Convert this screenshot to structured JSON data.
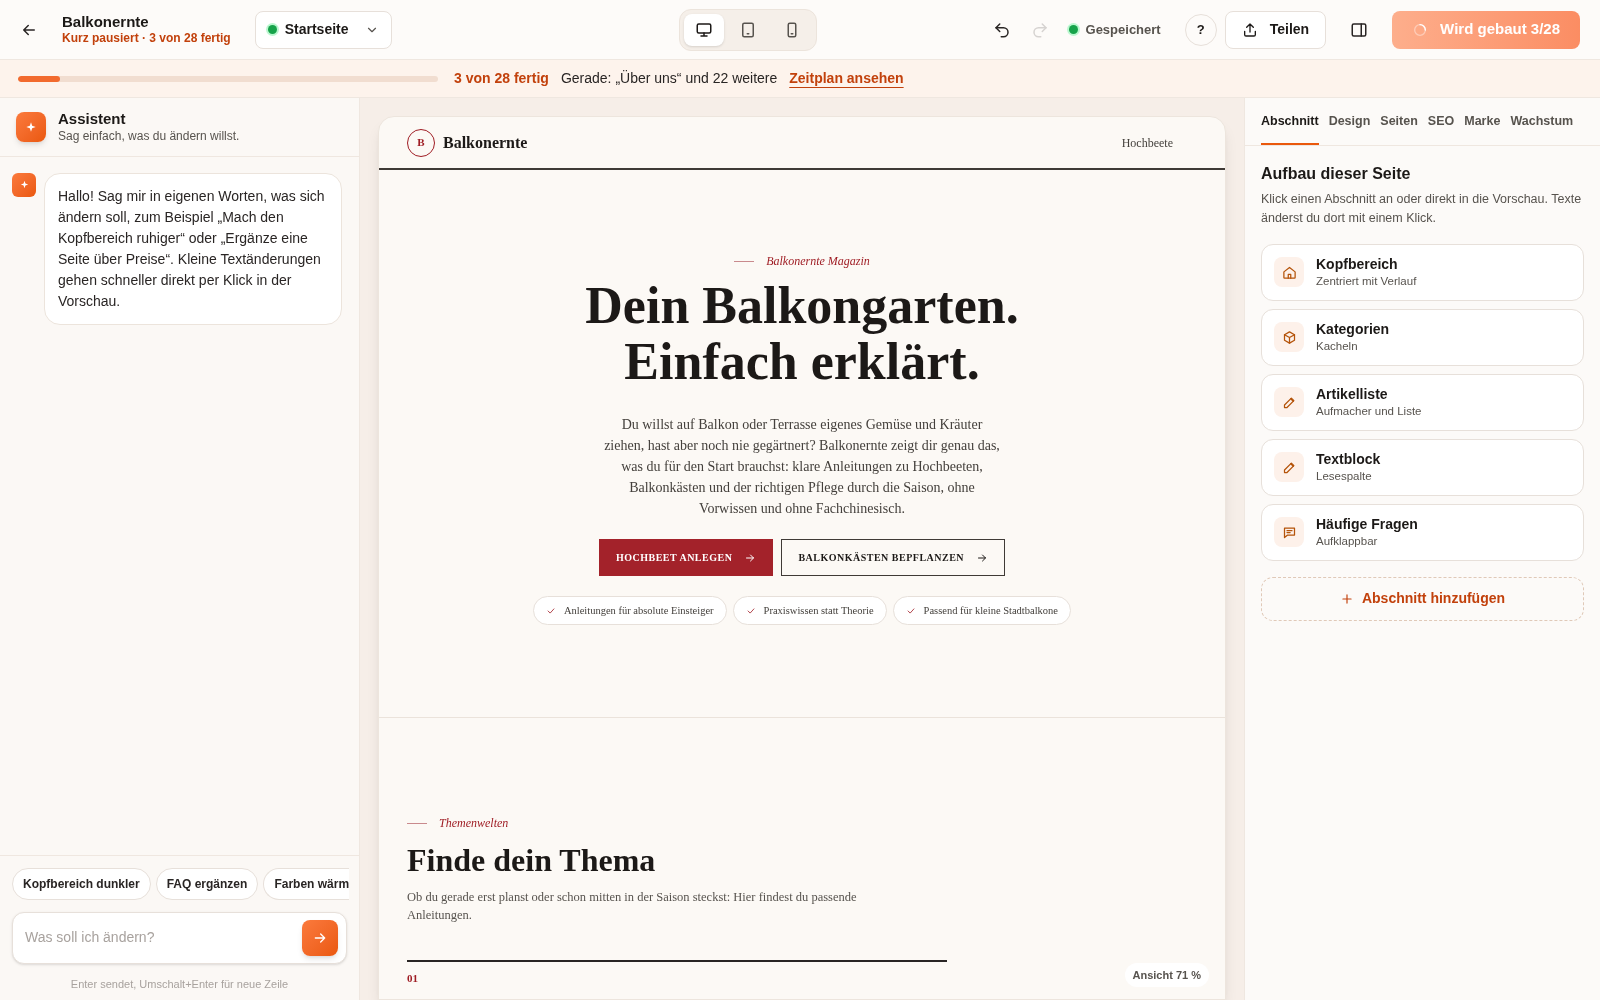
{
  "topbar": {
    "project": "Balkonernte",
    "status": "Kurz pausiert · 3 von 28 fertig",
    "page_select": "Startseite",
    "devices": [
      {
        "kind": "desktop",
        "selected": true
      },
      {
        "kind": "tablet",
        "selected": false
      },
      {
        "kind": "phone",
        "selected": false
      }
    ],
    "redo_disabled": true,
    "saved": "Gespeichert",
    "help": "?",
    "share": "Teilen",
    "build": "Wird gebaut 3/28"
  },
  "progress": {
    "level": 0.1,
    "count": "3 von 28 fertig",
    "current": "Gerade: „Über uns“ und 22 weitere",
    "link": "Zeitplan ansehen"
  },
  "assistant": {
    "title": "Assistent",
    "subtitle": "Sag einfach, was du ändern willst.",
    "messages": [
      "Hallo! Sag mir in eigenen Worten, was sich ändern soll, zum Beispiel „Mach den Kopfbereich ruhiger“ oder „Ergänze eine Seite über Preise“. Kleine Textänderungen gehen schneller direkt per Klick in der Vorschau."
    ],
    "suggestions": [
      "Kopfbereich dunkler",
      "FAQ ergänzen",
      "Farben wärm"
    ],
    "input_placeholder": "Was soll ich ändern?",
    "hint": "Enter sendet, Umschalt+Enter für neue Zeile"
  },
  "preview": {
    "logo_letter": "B",
    "brand": "Balkonernte",
    "nav": [
      "Hochbeete"
    ],
    "eyebrow": "Balkonernte Magazin",
    "headline_lines": [
      "Dein Balkongarten.",
      "Einfach erklärt."
    ],
    "intro": "Du willst auf Balkon oder Terrasse eigenes Gemüse und Kräuter ziehen, hast aber noch nie gegärtnert? Balkonernte zeigt dir genau das, was du für den Start brauchst: klare Anleitungen zu Hochbeeten, Balkonkästen und der richtigen Pflege durch die Saison, ohne Vorwissen und ohne Fachchinesisch.",
    "buttons": [
      {
        "label": "HOCHBEET ANLEGEN",
        "kind": "primary"
      },
      {
        "label": "BALKONKÄSTEN BEPFLANZEN",
        "kind": "outline"
      }
    ],
    "checks": [
      "Anleitungen für absolute Einsteiger",
      "Praxiswissen statt Theorie",
      "Passend für kleine Stadtbalkone"
    ],
    "section_eyebrow": "Themenwelten",
    "section_title": "Finde dein Thema",
    "section_text": "Ob du gerade erst planst oder schon mitten in der Saison steckst: Hier findest du passende Anleitungen.",
    "item_number": "01",
    "zoom": "Ansicht 71 %"
  },
  "inspector": {
    "tabs": [
      {
        "label": "Abschnitt",
        "selected": true
      },
      {
        "label": "Design",
        "selected": false
      },
      {
        "label": "Seiten",
        "selected": false
      },
      {
        "label": "SEO",
        "selected": false
      },
      {
        "label": "Marke",
        "selected": false
      },
      {
        "label": "Wachstum",
        "selected": false
      }
    ],
    "title": "Aufbau dieser Seite",
    "description": "Klick einen Abschnitt an oder direkt in die Vorschau. Texte änderst du dort mit einem Klick.",
    "sections": [
      {
        "kind": "house",
        "name": "Kopfbereich",
        "detail": "Zentriert mit Verlauf"
      },
      {
        "kind": "cube",
        "name": "Kategorien",
        "detail": "Kacheln"
      },
      {
        "kind": "pencil",
        "name": "Artikelliste",
        "detail": "Aufmacher und Liste"
      },
      {
        "kind": "pencil",
        "name": "Textblock",
        "detail": "Lesespalte"
      },
      {
        "kind": "chat",
        "name": "Häufige Fragen",
        "detail": "Aufklappbar"
      }
    ],
    "add": "Abschnitt hinzufügen"
  }
}
